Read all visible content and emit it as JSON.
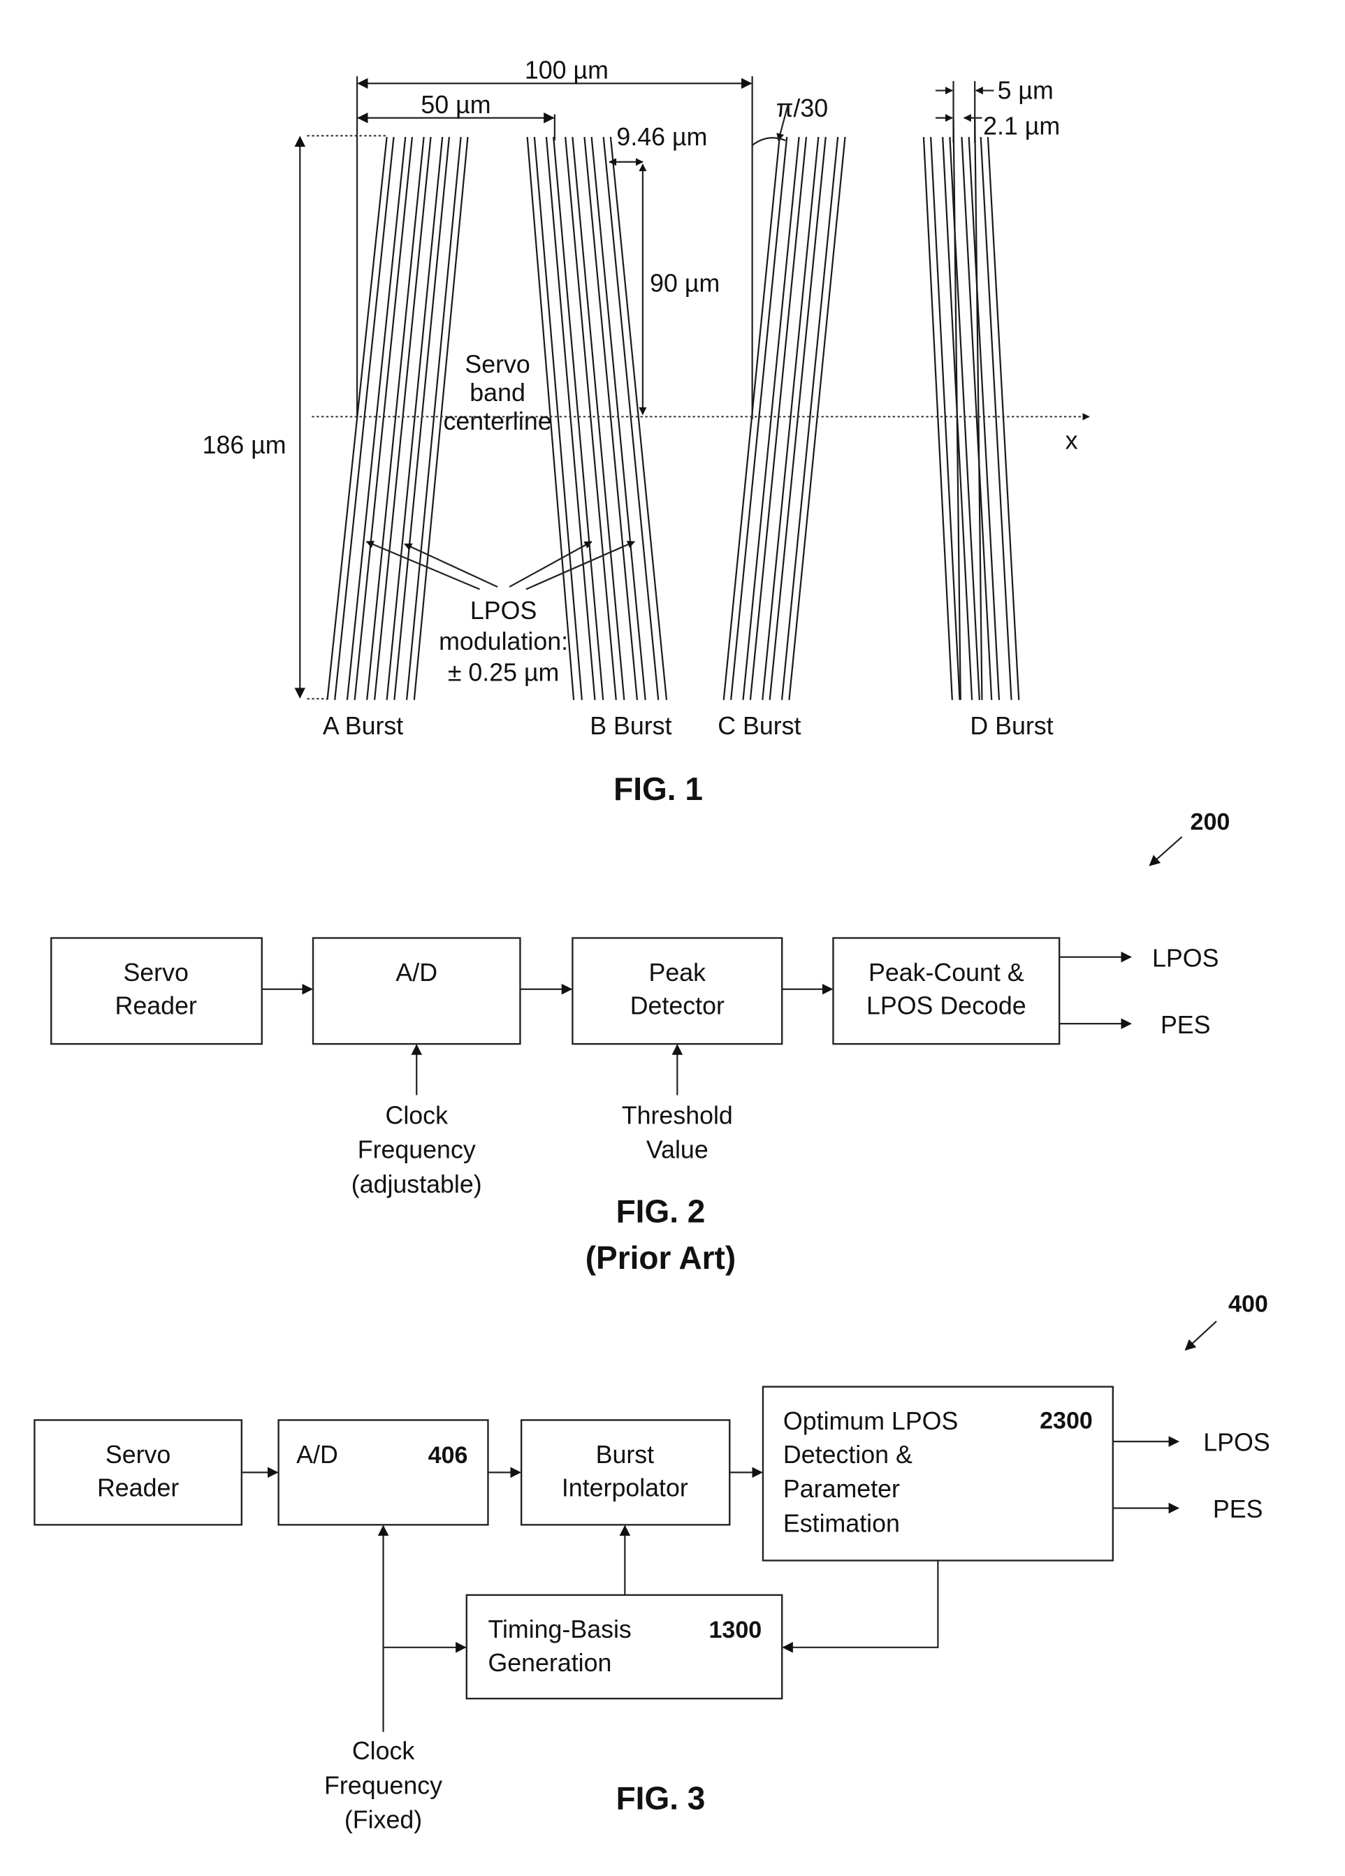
{
  "fig1": {
    "title": "FIG. 1",
    "dim_100": "100 µm",
    "dim_50": "50 µm",
    "dim_946": "9.46 µm",
    "dim_90": "90 µm",
    "dim_186": "186 µm",
    "angle": "π/30",
    "dim_5": "5 µm",
    "dim_21": "2.1 µm",
    "centerline_label": [
      "Servo",
      "band",
      "centerline"
    ],
    "axis_label": "x",
    "lpos_label": [
      "LPOS",
      "modulation:",
      "± 0.25 µm"
    ],
    "bursts": [
      {
        "label": "A Burst",
        "lines": 10
      },
      {
        "label": "B Burst",
        "lines": 10
      },
      {
        "label": "C Burst",
        "lines": 8
      },
      {
        "label": "D Burst",
        "lines": 8
      }
    ]
  },
  "fig2": {
    "title": "FIG. 2",
    "subtitle": "(Prior Art)",
    "ref": "200",
    "blocks": [
      {
        "id": "servo-reader",
        "lines": [
          "Servo",
          "Reader"
        ]
      },
      {
        "id": "ad",
        "lines": [
          "A/D"
        ]
      },
      {
        "id": "peak-detector",
        "lines": [
          "Peak",
          "Detector"
        ]
      },
      {
        "id": "peak-count",
        "lines": [
          "Peak-Count &",
          "LPOS Decode"
        ]
      }
    ],
    "inputs": [
      {
        "id": "clock",
        "lines": [
          "Clock",
          "Frequency",
          "(adjustable)"
        ]
      },
      {
        "id": "threshold",
        "lines": [
          "Threshold",
          "Value"
        ]
      }
    ],
    "outputs": [
      "LPOS",
      "PES"
    ]
  },
  "fig3": {
    "title": "FIG. 3",
    "ref": "400",
    "blocks": [
      {
        "id": "servo-reader",
        "lines": [
          "Servo",
          "Reader"
        ],
        "num": ""
      },
      {
        "id": "ad",
        "lines": [
          "A/D"
        ],
        "num": "406"
      },
      {
        "id": "burst-interpolator",
        "lines": [
          "Burst",
          "Interpolator"
        ],
        "num": ""
      },
      {
        "id": "optimum-lpos",
        "lines": [
          "Optimum LPOS",
          "Detection &",
          "Parameter",
          "Estimation"
        ],
        "num": "2300"
      },
      {
        "id": "timing-basis",
        "lines": [
          "Timing-Basis",
          "Generation"
        ],
        "num": "1300"
      }
    ],
    "inputs": [
      {
        "id": "clock",
        "lines": [
          "Clock",
          "Frequency",
          "(Fixed)"
        ]
      }
    ],
    "outputs": [
      "LPOS",
      "PES"
    ]
  }
}
